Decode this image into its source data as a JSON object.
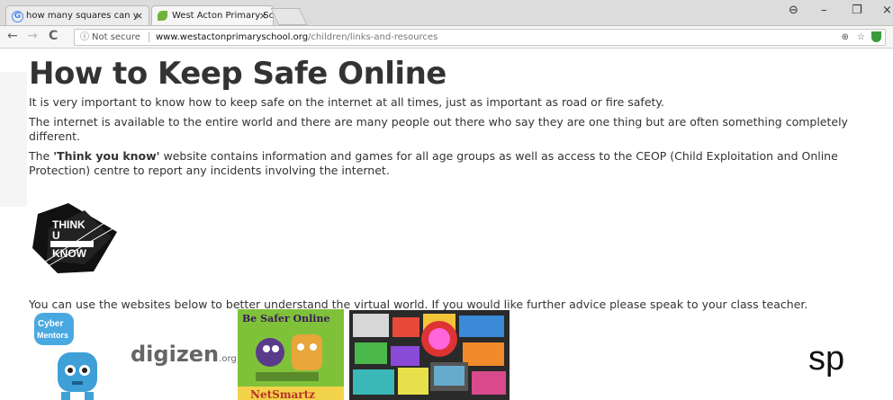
{
  "browser": {
    "tabs": [
      {
        "title": "how many squares can y",
        "favicon": "G",
        "active": false
      },
      {
        "title": "West Acton Primary Scho",
        "favicon": "leaf",
        "active": true
      }
    ],
    "close_glyph": "×",
    "window_controls": {
      "profile": "⊖",
      "minimize": "–",
      "maximize": "❐",
      "close": "×"
    },
    "nav": {
      "back": "←",
      "forward": "→",
      "reload": "C"
    },
    "address": {
      "info_icon": "ⓘ",
      "security_label": "Not secure",
      "host": "www.westactonprimaryschool.org",
      "path": "/children/links-and-resources",
      "zoom_icon": "⊕",
      "star_icon": "☆"
    }
  },
  "page": {
    "title": "How to Keep Safe Online",
    "paragraphs": [
      "It is very important to know how to keep safe on the internet at all times, just as important as road or fire safety.",
      "The internet is available to the entire world and there are many people out there who say they are one thing but are often something completely different."
    ],
    "think_para": {
      "prefix": "The ",
      "bold": "'Think you know'",
      "suffix": " website contains information and games for all age groups as well as access to the CEOP (Child Exploitation and Online Protection) centre to report any incidents involving the internet."
    },
    "logos": {
      "think_u_know": [
        "THINK",
        "U",
        "KNOW"
      ],
      "cyber_mentors": [
        "Cyber",
        "Mentors"
      ],
      "digizen": {
        "name": "digizen",
        "suffix": ".org"
      },
      "netsmartz": {
        "top": "Be Safer Online",
        "bottom": "NetSmartz"
      }
    },
    "bottom_paragraph": "You can use the websites below to better understand the virtual world. If you would like further advice please speak to your class teacher.",
    "overlay_text": "sp"
  },
  "colors": {
    "accent_green": "#3a9b3a",
    "netsmartz_green": "#7fc23a",
    "title": "#333333"
  }
}
